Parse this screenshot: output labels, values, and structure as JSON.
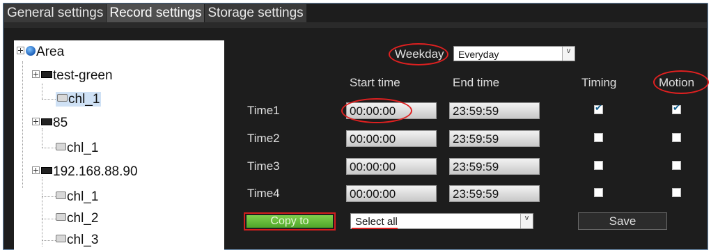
{
  "tabs": [
    "General settings",
    "Record settings",
    "Storage settings"
  ],
  "tree": {
    "root": "Area",
    "devices": [
      {
        "name": "test-green",
        "channels": [
          "chl_1"
        ]
      },
      {
        "name": "85",
        "channels": [
          "chl_1"
        ]
      },
      {
        "name": "192.168.88.90",
        "channels": [
          "chl_1",
          "chl_2",
          "chl_3"
        ]
      }
    ]
  },
  "schedule": {
    "weekday_label": "Weekday",
    "weekday_value": "Everyday",
    "headers": {
      "start": "Start time",
      "end": "End time",
      "timing": "Timing",
      "motion": "Motion"
    },
    "rows": [
      {
        "label": "Time1",
        "start": "00:00:00",
        "end": "23:59:59",
        "timing": true,
        "motion": true
      },
      {
        "label": "Time2",
        "start": "00:00:00",
        "end": "23:59:59",
        "timing": false,
        "motion": false
      },
      {
        "label": "Time3",
        "start": "00:00:00",
        "end": "23:59:59",
        "timing": false,
        "motion": false
      },
      {
        "label": "Time4",
        "start": "00:00:00",
        "end": "23:59:59",
        "timing": false,
        "motion": false
      }
    ],
    "copy_label": "Copy to",
    "copy_target": "Select all",
    "save_label": "Save"
  },
  "colors": {
    "annotation": "#e02020",
    "accent_green": "#5cb535",
    "checkmark": "#0c5a8a"
  }
}
